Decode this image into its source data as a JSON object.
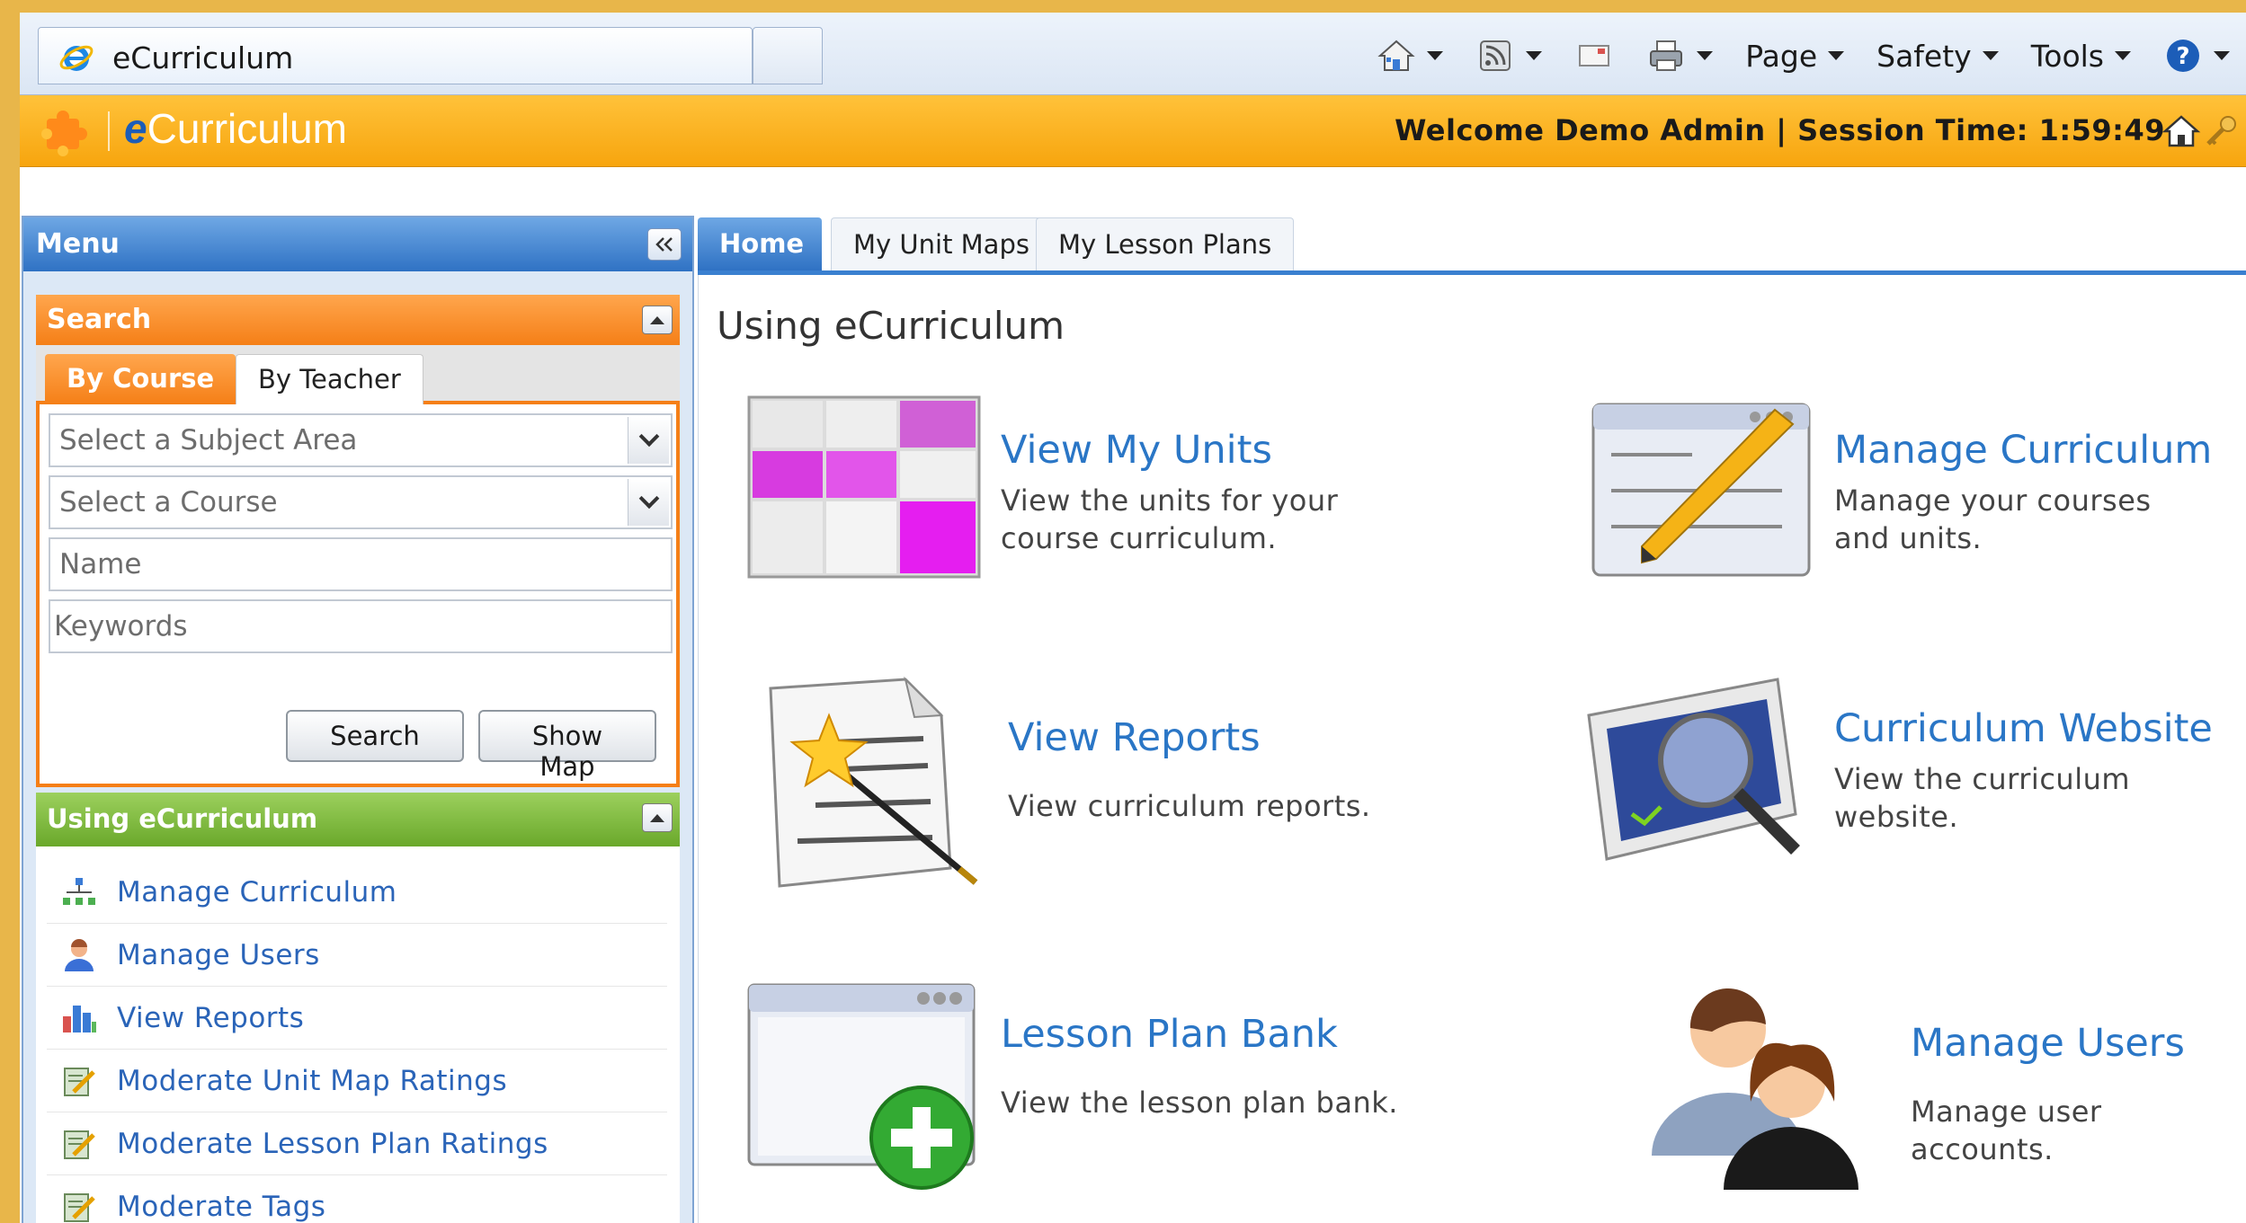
{
  "browser": {
    "tab_title": "eCurriculum",
    "menus": [
      "Page",
      "Safety",
      "Tools"
    ]
  },
  "header": {
    "logo_text_e": "e",
    "logo_text_rest": "Curriculum",
    "welcome": "Welcome Demo Admin | Session Time: 1:59:49"
  },
  "menu": {
    "title": "Menu",
    "search": {
      "title": "Search",
      "tabs": [
        "By Course",
        "By Teacher"
      ],
      "subject_placeholder": "Select a Subject Area",
      "course_placeholder": "Select a Course",
      "name_placeholder": "Name",
      "keywords_placeholder": "Keywords",
      "search_button": "Search",
      "map_button": "Show Map"
    },
    "using": {
      "title": "Using eCurriculum",
      "items": [
        {
          "label": "Manage Curriculum",
          "icon": "org-chart-icon"
        },
        {
          "label": "Manage Users",
          "icon": "user-icon"
        },
        {
          "label": "View Reports",
          "icon": "bar-chart-icon"
        },
        {
          "label": "Moderate Unit Map Ratings",
          "icon": "edit-note-icon"
        },
        {
          "label": "Moderate Lesson Plan Ratings",
          "icon": "edit-note-icon"
        },
        {
          "label": "Moderate Tags",
          "icon": "edit-note-icon"
        }
      ]
    }
  },
  "main": {
    "tabs": [
      "Home",
      "My Unit Maps",
      "My Lesson Plans"
    ],
    "title": "Using eCurriculum",
    "tiles": {
      "view_units": {
        "title": "View My Units",
        "desc1": "View the units for your",
        "desc2": "course curriculum."
      },
      "manage_curriculum": {
        "title": "Manage Curriculum",
        "desc1": "Manage your courses",
        "desc2": "and units."
      },
      "view_reports": {
        "title": "View Reports",
        "desc1": "View curriculum reports."
      },
      "curriculum_website": {
        "title": "Curriculum Website",
        "desc1": "View the curriculum",
        "desc2": "website."
      },
      "lesson_plan_bank": {
        "title": "Lesson Plan Bank",
        "desc1": "View the lesson plan bank."
      },
      "manage_users": {
        "title": "Manage Users",
        "desc1": "Manage user accounts."
      }
    }
  },
  "colors": {
    "header_orange": "#f7a50e",
    "menu_blue": "#2f72c4",
    "search_orange": "#f57f17",
    "using_green": "#6aa82b",
    "link_blue": "#2a76c6"
  }
}
